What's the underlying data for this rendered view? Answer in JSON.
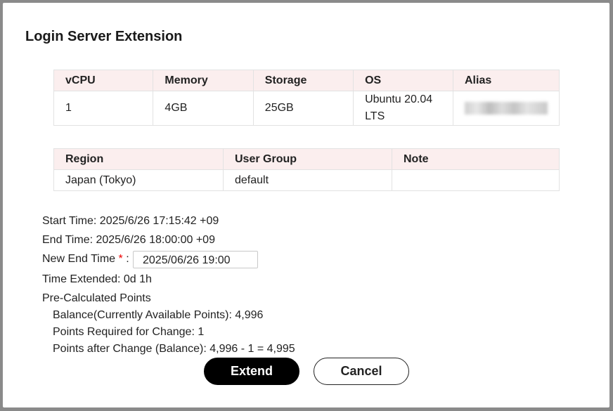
{
  "dialog": {
    "title": "Login Server Extension"
  },
  "server_table": {
    "headers": [
      "vCPU",
      "Memory",
      "Storage",
      "OS",
      "Alias"
    ],
    "row": {
      "vcpu": "1",
      "memory": "4GB",
      "storage": "25GB",
      "os": "Ubuntu 20.04 LTS",
      "alias": "■■■■■■■■"
    }
  },
  "region_table": {
    "headers": [
      "Region",
      "User Group",
      "Note"
    ],
    "row": {
      "region": "Japan (Tokyo)",
      "user_group": "default",
      "note": ""
    }
  },
  "details": {
    "start_time": "Start Time: 2025/6/26 17:15:42 +09",
    "end_time": "End Time: 2025/6/26 18:00:00 +09",
    "new_end_time_label": "New End Time",
    "required_mark": "*",
    "colon": ":",
    "new_end_time_value": "2025/06/26 19:00",
    "time_extended": "Time Extended: 0d 1h",
    "pre_calc_heading": "Pre-Calculated Points",
    "balance": "Balance(Currently Available Points): 4,996",
    "points_required": "Points Required for Change: 1",
    "points_after": "Points after Change (Balance): 4,996 - 1 = 4,995"
  },
  "buttons": {
    "extend": "Extend",
    "cancel": "Cancel"
  }
}
